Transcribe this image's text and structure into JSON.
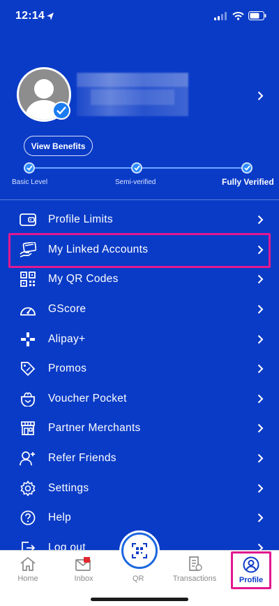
{
  "status_bar": {
    "time": "12:14"
  },
  "profile": {
    "view_benefits_label": "View Benefits",
    "steps": [
      "Basic Level",
      "Semi-verified",
      "Fully Verified"
    ]
  },
  "menu": [
    {
      "label": "Profile Limits",
      "icon": "wallet-icon"
    },
    {
      "label": "My Linked Accounts",
      "icon": "linked-card-icon"
    },
    {
      "label": "My QR Codes",
      "icon": "qr-code-icon"
    },
    {
      "label": "GScore",
      "icon": "gauge-icon"
    },
    {
      "label": "Alipay+",
      "icon": "alipay-plus-icon"
    },
    {
      "label": "Promos",
      "icon": "tag-icon"
    },
    {
      "label": "Voucher Pocket",
      "icon": "pocket-icon"
    },
    {
      "label": "Partner Merchants",
      "icon": "storefront-icon"
    },
    {
      "label": "Refer Friends",
      "icon": "add-friend-icon"
    },
    {
      "label": "Settings",
      "icon": "gear-icon"
    },
    {
      "label": "Help",
      "icon": "help-icon"
    },
    {
      "label": "Log out",
      "icon": "logout-icon"
    }
  ],
  "bottom_nav": {
    "home": "Home",
    "inbox": "Inbox",
    "qr": "QR",
    "transactions": "Transactions",
    "profile": "Profile"
  },
  "colors": {
    "brand": "#0a3bc7",
    "highlight": "#e2188f",
    "accent": "#1b7cf2"
  }
}
